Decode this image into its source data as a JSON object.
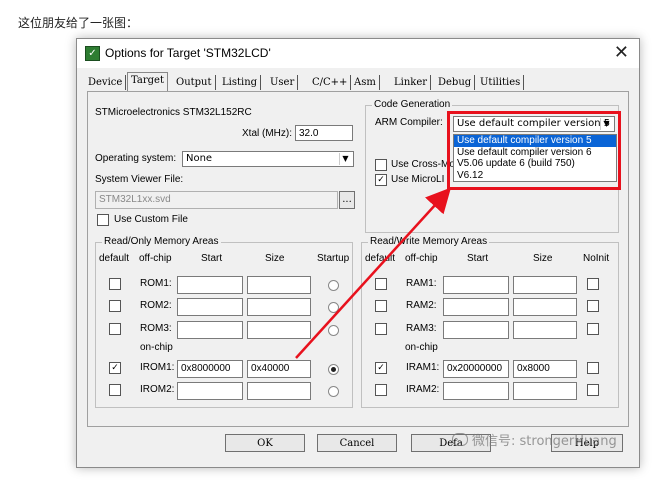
{
  "caption": "这位朋友给了一张图：",
  "dialog": {
    "title": "Options for Target 'STM32LCD'",
    "tabs": [
      "Device",
      "Target",
      "Output",
      "Listing",
      "User",
      "C/C++",
      "Asm",
      "Linker",
      "Debug",
      "Utilities"
    ],
    "active_tab": "Target"
  },
  "target": {
    "chip": "STMicroelectronics STM32L152RC",
    "xtal_label": "Xtal (MHz):",
    "xtal_value": "32.0",
    "os_label": "Operating system:",
    "os_value": "None",
    "svf_label": "System Viewer File:",
    "svf_value": "STM32L1xx.svd",
    "svf_browse": "...",
    "use_custom_file": "Use Custom File"
  },
  "codegen": {
    "group_label": "Code Generation",
    "arm_compiler_label": "ARM Compiler:",
    "selected": "Use default compiler version 5",
    "options": [
      "Use default compiler version 5",
      "Use default compiler version 6",
      "V5.06 update 6 (build 750)",
      "V6.12"
    ],
    "use_cross_module": "Use Cross-Mod",
    "use_microlib": "Use MicroLI"
  },
  "rom": {
    "group_label": "Read/Only Memory Areas",
    "headers": {
      "default": "default",
      "offchip": "off-chip",
      "start": "Start",
      "size": "Size",
      "startup": "Startup"
    },
    "onchip_label": "on-chip",
    "rows": [
      {
        "name": "ROM1:",
        "start": "",
        "size": "",
        "default": false,
        "startup": false
      },
      {
        "name": "ROM2:",
        "start": "",
        "size": "",
        "default": false,
        "startup": false
      },
      {
        "name": "ROM3:",
        "start": "",
        "size": "",
        "default": false,
        "startup": false
      },
      {
        "name": "IROM1:",
        "start": "0x8000000",
        "size": "0x40000",
        "default": true,
        "startup": true
      },
      {
        "name": "IROM2:",
        "start": "",
        "size": "",
        "default": false,
        "startup": false
      }
    ]
  },
  "ram": {
    "group_label": "Read/Write Memory Areas",
    "headers": {
      "default": "default",
      "offchip": "off-chip",
      "start": "Start",
      "size": "Size",
      "noinit": "NoInit"
    },
    "onchip_label": "on-chip",
    "rows": [
      {
        "name": "RAM1:",
        "start": "",
        "size": "",
        "default": false,
        "noinit": false
      },
      {
        "name": "RAM2:",
        "start": "",
        "size": "",
        "default": false,
        "noinit": false
      },
      {
        "name": "RAM3:",
        "start": "",
        "size": "",
        "default": false,
        "noinit": false
      },
      {
        "name": "IRAM1:",
        "start": "0x20000000",
        "size": "0x8000",
        "default": true,
        "noinit": false
      },
      {
        "name": "IRAM2:",
        "start": "",
        "size": "",
        "default": false,
        "noinit": false
      }
    ]
  },
  "buttons": {
    "ok": "OK",
    "cancel": "Cancel",
    "defaults": "Defa",
    "help": "Help"
  },
  "watermark": "微信号: strongerHuang",
  "colors": {
    "highlight": "#e8111d",
    "selection": "#0a64d6"
  }
}
